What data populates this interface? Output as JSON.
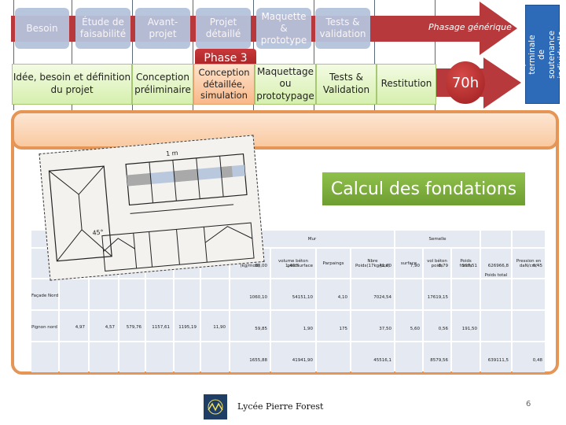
{
  "phasing": {
    "generic_steps": [
      "Besoin",
      "Étude de faisabilité",
      "Avant-projet",
      "Projet détaillé",
      "Maquette & prototype",
      "Tests & validation"
    ],
    "generic_label": "Phasage générique",
    "phase_badge": "Phase 3",
    "project_steps": [
      "Idée, besoin et définition du projet",
      "Conception préliminaire",
      "Conception détaillée, simulation",
      "Maquettage ou prototypage",
      "Tests & Validation",
      "Restitution"
    ],
    "active_step_index": 2,
    "duration": "70h",
    "final_exam": "Épreuve terminale de soutenance individuelle"
  },
  "section": {
    "title": "Calcul des fondations"
  },
  "table": {
    "group_headers": {
      "mur": "Mur",
      "semelle": "Semelle"
    },
    "col_headers": {
      "modules": "modules (kg/mod)",
      "volume_beton_mur": "volume béton poids",
      "parpaings": "Parpaings",
      "nbre": "Nbre Poids(17kg/pce)",
      "surface": "surface",
      "vol_beton": "vol béton poids",
      "poids_fonda": "Poids fonda",
      "poids_total": "Poids total",
      "pression": "Pression en daN/cm²"
    },
    "rows": [
      {
        "label": "Façade Nord",
        "left": [],
        "r1": [
          "50,00",
          "1,40 Surface",
          "",
          "41,00",
          "7,90",
          "0,79",
          "597,51",
          "626966,8",
          "0,45"
        ],
        "r2": [
          "1060,10",
          "54151,10",
          "4,10",
          "7024,54",
          "",
          "17619,15",
          "",
          "",
          ""
        ]
      },
      {
        "label": "Pignon nord",
        "left": [
          "4,97",
          "4,57",
          "579,76",
          "1157,61",
          "1195,19",
          "11,90"
        ],
        "r1": [
          "59,85",
          "1,90",
          "175",
          "37,50",
          "5,60",
          "0,56",
          "191,50",
          "",
          ""
        ],
        "r2": [
          "1655,88",
          "41941,90",
          "",
          "45516,1",
          "",
          "8579,56",
          "",
          "639111,5",
          "0,48"
        ]
      }
    ]
  },
  "footer": {
    "school": "Lycée Pierre Forest",
    "page": "6"
  },
  "drawing": {
    "label_1m": "1 m",
    "label_angle": "45°"
  },
  "colors": {
    "accent_red": "#b8393c",
    "accent_orange": "#e59556",
    "accent_green": "#7aab3a",
    "accent_blue": "#2d6ab7"
  }
}
